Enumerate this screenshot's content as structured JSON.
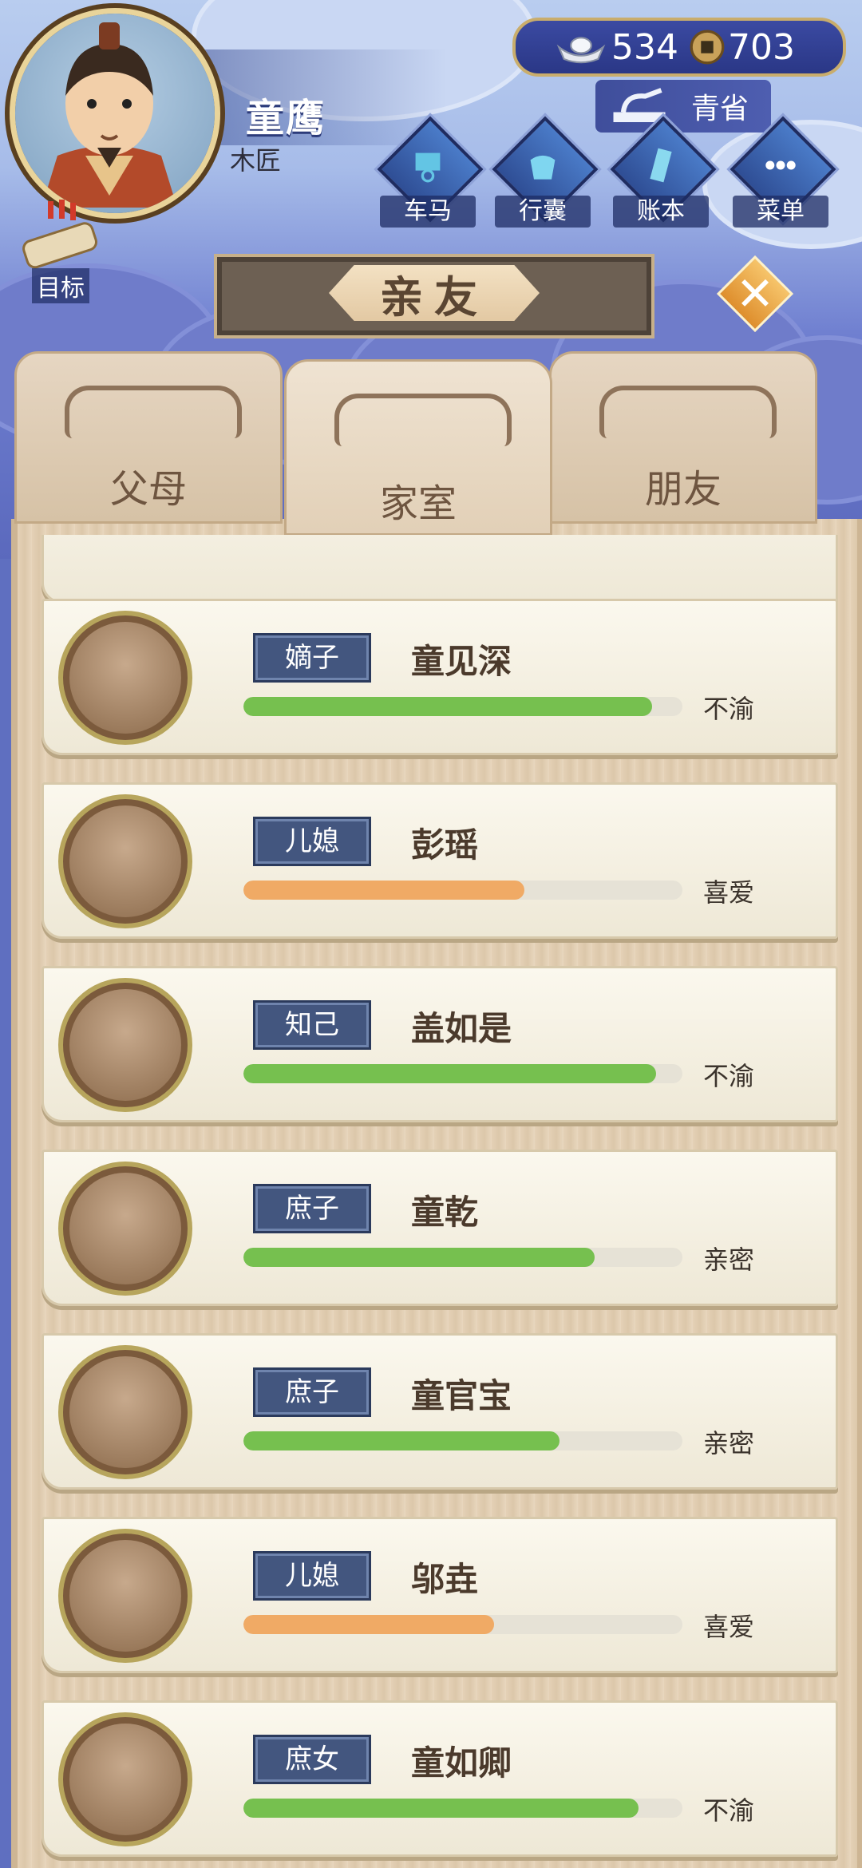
{
  "player": {
    "name": "童鹰",
    "title": "木匠"
  },
  "currency": {
    "silver": "534",
    "copper": "703"
  },
  "region": {
    "label": "青省"
  },
  "nav": [
    {
      "label": "车马",
      "icon": "carriage-icon"
    },
    {
      "label": "行囊",
      "icon": "bag-icon"
    },
    {
      "label": "账本",
      "icon": "ledger-icon"
    },
    {
      "label": "菜单",
      "icon": "more-icon"
    }
  ],
  "goal": {
    "label": "目标"
  },
  "page_title": "亲友",
  "tabs": [
    {
      "label": "父母",
      "active": false
    },
    {
      "label": "家室",
      "active": true
    },
    {
      "label": "朋友",
      "active": false
    }
  ],
  "colors": {
    "green": "#76c04f",
    "orange": "#f0aa65"
  },
  "members": [
    {
      "role": "嫡子",
      "name": "童见深",
      "status": "不渝",
      "affinity": 0.93,
      "bar_color": "green"
    },
    {
      "role": "儿媳",
      "name": "彭瑶",
      "status": "喜爱",
      "affinity": 0.64,
      "bar_color": "orange"
    },
    {
      "role": "知己",
      "name": "盖如是",
      "status": "不渝",
      "affinity": 0.94,
      "bar_color": "green"
    },
    {
      "role": "庶子",
      "name": "童乾",
      "status": "亲密",
      "affinity": 0.8,
      "bar_color": "green"
    },
    {
      "role": "庶子",
      "name": "童官宝",
      "status": "亲密",
      "affinity": 0.72,
      "bar_color": "green"
    },
    {
      "role": "儿媳",
      "name": "邬垚",
      "status": "喜爱",
      "affinity": 0.57,
      "bar_color": "orange"
    },
    {
      "role": "庶女",
      "name": "童如卿",
      "status": "不渝",
      "affinity": 0.9,
      "bar_color": "green"
    }
  ]
}
